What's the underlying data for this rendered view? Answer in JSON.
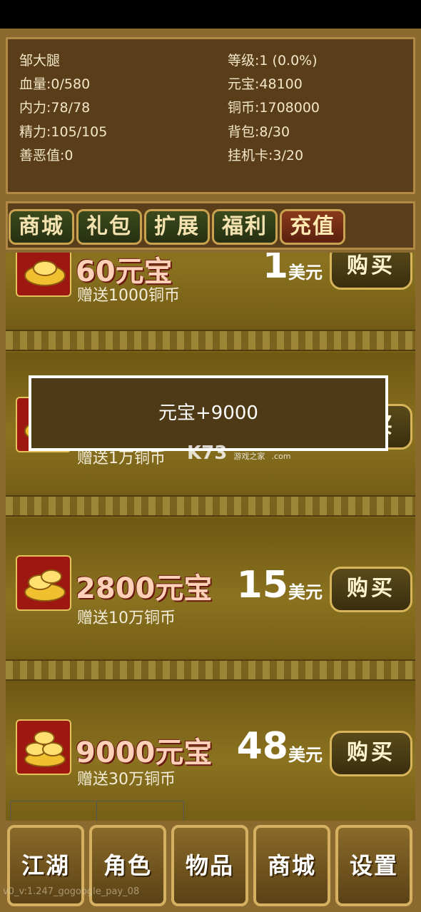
{
  "stats": {
    "name": "邹大腿",
    "level": "等级:1 (0.0%)",
    "hp": "血量:0/580",
    "yuanbao": "元宝:48100",
    "neili": "内力:78/78",
    "tongbi": "铜币:1708000",
    "jingli": "精力:105/105",
    "bag": "背包:8/30",
    "shane": "善恶值:0",
    "guaji": "挂机卡:3/20"
  },
  "tabs": [
    {
      "label": "商城",
      "active": false
    },
    {
      "label": "礼包",
      "active": false
    },
    {
      "label": "扩展",
      "active": false
    },
    {
      "label": "福利",
      "active": false
    },
    {
      "label": "充值",
      "active": true
    }
  ],
  "items": [
    {
      "amount": "60元宝",
      "gift": "赠送1000铜币",
      "price": "1",
      "unit": "美元",
      "buy": "购买"
    },
    {
      "amount": "",
      "gift": "赠送1万铜币",
      "price": "",
      "unit": "",
      "buy": "购买"
    },
    {
      "amount": "2800元宝",
      "gift": "赠送10万铜币",
      "price": "15",
      "unit": "美元",
      "buy": "购买"
    },
    {
      "amount": "9000元宝",
      "gift": "赠送30万铜币",
      "price": "48",
      "unit": "美元",
      "buy": "购买"
    }
  ],
  "toast": "元宝+9000",
  "watermark": {
    "brand": "K73",
    "sub": "游戏之家",
    "domain": ".com"
  },
  "nav": [
    {
      "label": "江湖"
    },
    {
      "label": "角色"
    },
    {
      "label": "物品"
    },
    {
      "label": "商城"
    },
    {
      "label": "设置"
    }
  ],
  "version": "v0_v:1.247_gogoogle_pay_08",
  "colors": {
    "panel": "#5a3e1a",
    "border": "#b08a44",
    "activeTab": "#8a3a1a",
    "listBg": "#7a6218"
  }
}
